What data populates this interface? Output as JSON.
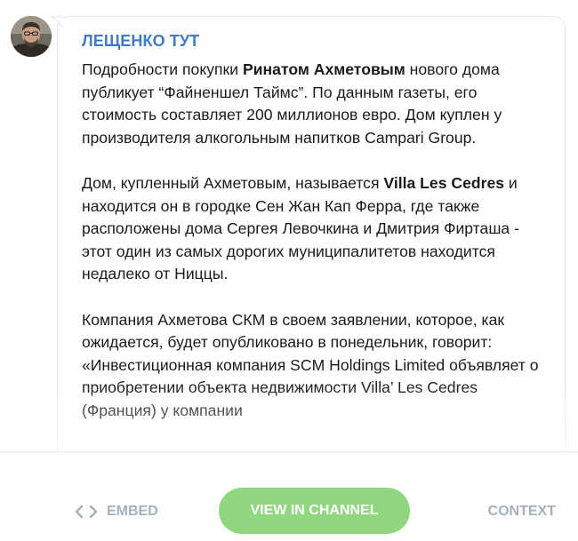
{
  "post": {
    "author": "ЛЕЩЕНКО ТУТ",
    "avatar_icon": "author-avatar-photo",
    "paragraphs": [
      {
        "parts": [
          {
            "text": "Подробности покупки ",
            "bold": false
          },
          {
            "text": "Ринатом Ахметовым",
            "bold": true
          },
          {
            "text": " нового дома публикует “Файненшел Таймс”. По данным газеты, его стоимость составляет 200 миллионов евро. Дом куплен у производителя алкогольным напитков Campari Group.",
            "bold": false
          }
        ]
      },
      {
        "parts": [
          {
            "text": "Дом, купленный Ахметовым, называется ",
            "bold": false
          },
          {
            "text": "Villa Les Cedres",
            "bold": true
          },
          {
            "text": " и находится он в городке Сен Жан Кап Ферра, где также расположены дома Сергея Левочкина и Дмитрия Фирташа - этот один из самых дорогих муниципалитетов находится недалеко от Ниццы.",
            "bold": false
          }
        ]
      },
      {
        "parts": [
          {
            "text": "Компания Ахметова СКМ в своем заявлении, которое, как ожидается, будет опубликовано в понедельник, говорит: «Инвестиционная компания SCM Holdings Limited объявляет о приобретении объекта недвижимости Villa’ Les Cedres (Франция) у компании",
            "bold": false
          }
        ]
      }
    ]
  },
  "footer": {
    "embed_label": "EMBED",
    "embed_icon": "code-brackets-icon",
    "view_label": "VIEW IN CHANNEL",
    "context_label": "CONTEXT"
  },
  "colors": {
    "author": "#3f7cc6",
    "button_bg": "#91d77f",
    "footer_link": "#a4b1bd",
    "text": "#1b1b1b"
  }
}
